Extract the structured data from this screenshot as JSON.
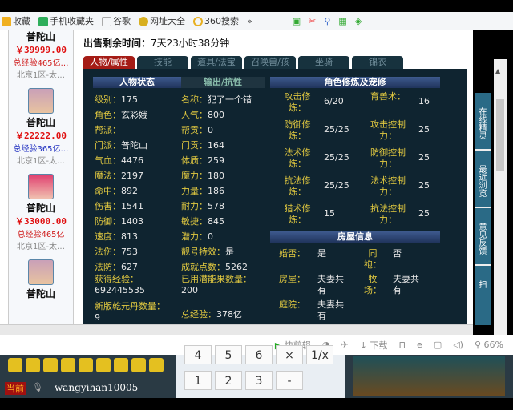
{
  "toolbar": {
    "items": [
      "收藏",
      "手机收藏夹",
      "谷歌",
      "网址大全",
      "360搜索"
    ],
    "more": "»"
  },
  "listings": [
    {
      "school": "普陀山",
      "price": "￥39999.00",
      "exp": "总经验465亿…",
      "server": "北京1区-太…",
      "exp_color": "#d02020"
    },
    {
      "school": "普陀山",
      "price": "￥22222.00",
      "exp": "总经验365亿…",
      "server": "北京1区-太…",
      "exp_color": "#2030c0"
    },
    {
      "school": "普陀山",
      "price": "￥33000.00",
      "exp": "总经验465亿",
      "server": "北京1区-太…",
      "exp_color": "#d02020"
    },
    {
      "school": "普陀山"
    }
  ],
  "sale": {
    "label": "出售剩余时间：",
    "value": "7天23小时38分钟"
  },
  "tabs": [
    "人物/属性",
    "技能",
    "道具/法宝",
    "召唤兽/孩",
    "坐骑",
    "锦衣"
  ],
  "status_section": {
    "title": "人物状态",
    "subtitle": "输出/抗性",
    "left": [
      [
        "级别：",
        "175"
      ],
      [
        "角色：",
        "玄彩娥"
      ],
      [
        "帮派：",
        ""
      ],
      [
        "门派：",
        "普陀山"
      ],
      [
        "气血：",
        "4476"
      ],
      [
        "魔法：",
        "2197"
      ],
      [
        "命中：",
        "892"
      ],
      [
        "伤害：",
        "1541"
      ],
      [
        "防御：",
        "1403"
      ],
      [
        "速度：",
        "813"
      ],
      [
        "法伤：",
        "753"
      ],
      [
        "法防：",
        "627"
      ]
    ],
    "right": [
      [
        "名称：",
        "犯了一个错"
      ],
      [
        "人气：",
        "800"
      ],
      [
        "帮贡：",
        "0"
      ],
      [
        "门贡：",
        "164"
      ],
      [
        "体质：",
        "259"
      ],
      [
        "魔力：",
        "180"
      ],
      [
        "力量：",
        "186"
      ],
      [
        "耐力：",
        "578"
      ],
      [
        "敏捷：",
        "845"
      ],
      [
        "潜力：",
        "0"
      ],
      [
        "靓号特效：",
        "是"
      ],
      [
        "成就点数：",
        "5262"
      ]
    ],
    "exp_label": "获得经验：",
    "exp_value": "692445535",
    "fruit_label": "已用潜能果数量：",
    "fruit_value": "200",
    "dan_label": "新版乾元丹数量：",
    "dan_value": "9",
    "total_label": "总经验：",
    "total_value": "378亿"
  },
  "cultivation": {
    "title": "角色修炼及宠修",
    "left": [
      [
        "攻击修炼：",
        "6/20"
      ],
      [
        "防御修炼：",
        "25/25"
      ],
      [
        "法术修炼：",
        "25/25"
      ],
      [
        "抗法修炼：",
        "25/25"
      ],
      [
        "猎术修炼：",
        "15"
      ]
    ],
    "right": [
      [
        "育兽术：",
        "16"
      ],
      [
        "攻击控制力：",
        "25"
      ],
      [
        "防御控制力：",
        "25"
      ],
      [
        "法术控制力：",
        "25"
      ],
      [
        "抗法控制力：",
        "25"
      ]
    ]
  },
  "house": {
    "title": "房屋信息",
    "items": [
      [
        "婚否：",
        "是"
      ],
      [
        "同袍：",
        "否"
      ],
      [
        "房屋：",
        "夫妻共有"
      ],
      [
        "牧场：",
        "夫妻共有"
      ],
      [
        "庭院：",
        "夫妻共有"
      ]
    ]
  },
  "right_sidebar": [
    "在线精灵",
    "最近浏览",
    "意见反馈",
    "扫"
  ],
  "statusbar": {
    "clip": "快剪辑",
    "download": "下载",
    "zoom": "66%"
  },
  "calc_keys": [
    "4",
    "5",
    "6",
    "×",
    "1/x",
    "1",
    "2",
    "3",
    "-"
  ],
  "game": {
    "channel": "当前",
    "input": "wangyihan10005"
  }
}
